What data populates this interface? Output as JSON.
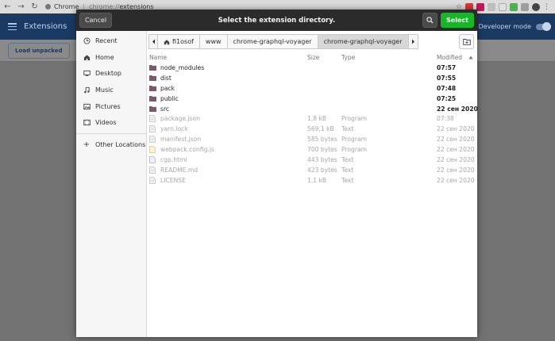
{
  "browser": {
    "app_name": "Chrome",
    "url_scheme": "chrome://",
    "url_path": "extensions",
    "header_title": "Extensions",
    "developer_mode_label": "Developer mode",
    "load_unpacked_label": "Load unpacked"
  },
  "dialog": {
    "title": "Select the extension directory.",
    "cancel_label": "Cancel",
    "select_label": "Select",
    "sidebar": [
      {
        "label": "Recent",
        "icon": "clock-icon"
      },
      {
        "label": "Home",
        "icon": "home-icon"
      },
      {
        "label": "Desktop",
        "icon": "desktop-icon"
      },
      {
        "label": "Music",
        "icon": "music-icon"
      },
      {
        "label": "Pictures",
        "icon": "pictures-icon"
      },
      {
        "label": "Videos",
        "icon": "videos-icon"
      }
    ],
    "other_locations_label": "Other Locations",
    "path": [
      "fi1osof",
      "www",
      "chrome-graphql-voyager",
      "chrome-graphql-voyager"
    ],
    "columns": {
      "name": "Name",
      "size": "Size",
      "type": "Type",
      "modified": "Modified"
    },
    "folders": [
      {
        "name": "node_modules",
        "modified": "07:57"
      },
      {
        "name": "dist",
        "modified": "07:55"
      },
      {
        "name": "pack",
        "modified": "07:48"
      },
      {
        "name": "public",
        "modified": "07:25"
      },
      {
        "name": "src",
        "modified": "22 сен 2020"
      }
    ],
    "files": [
      {
        "name": "package.json",
        "size": "1,8 kB",
        "type": "Program",
        "modified": "07:38"
      },
      {
        "name": "yarn.lock",
        "size": "569,1 kB",
        "type": "Text",
        "modified": "22 сен 2020"
      },
      {
        "name": "manifest.json",
        "size": "585 bytes",
        "type": "Program",
        "modified": "22 сен 2020"
      },
      {
        "name": "webpack.config.js",
        "size": "700 bytes",
        "type": "Program",
        "modified": "22 сен 2020"
      },
      {
        "name": "cgp.html",
        "size": "443 bytes",
        "type": "Text",
        "modified": "22 сен 2020"
      },
      {
        "name": "README.md",
        "size": "423 bytes",
        "type": "Text",
        "modified": "22 сен 2020"
      },
      {
        "name": "LICENSE",
        "size": "1,1 kB",
        "type": "Text",
        "modified": "22 сен 2020"
      }
    ]
  },
  "colors": {
    "header_dark": "#2b2b2b",
    "select_green": "#18b42a",
    "folder_icon": "#7a5a6a",
    "extensions_header": "#1a3a63"
  }
}
